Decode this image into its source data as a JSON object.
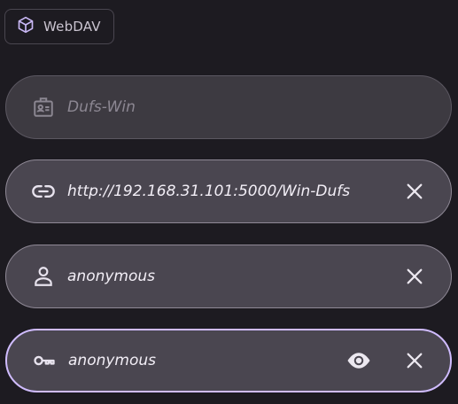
{
  "chip": {
    "label": "WebDAV",
    "icon": "cube-icon"
  },
  "fields": {
    "name": {
      "value": "Dufs-Win",
      "icon": "badge-icon",
      "state": "disabled"
    },
    "url": {
      "value": "http://192.168.31.101:5000/Win-Dufs",
      "icon": "link-icon",
      "trailing": "clear-icon"
    },
    "username": {
      "value": "anonymous",
      "icon": "person-icon",
      "trailing": "clear-icon"
    },
    "password": {
      "value": "anonymous",
      "icon": "key-icon",
      "trailing": [
        "visibility-icon",
        "clear-icon"
      ],
      "state": "focused"
    }
  },
  "colors": {
    "background": "#1d1b21",
    "field_fill": "#4a4650",
    "focus_outline": "#d0bcff",
    "text": "#f2eef6"
  }
}
